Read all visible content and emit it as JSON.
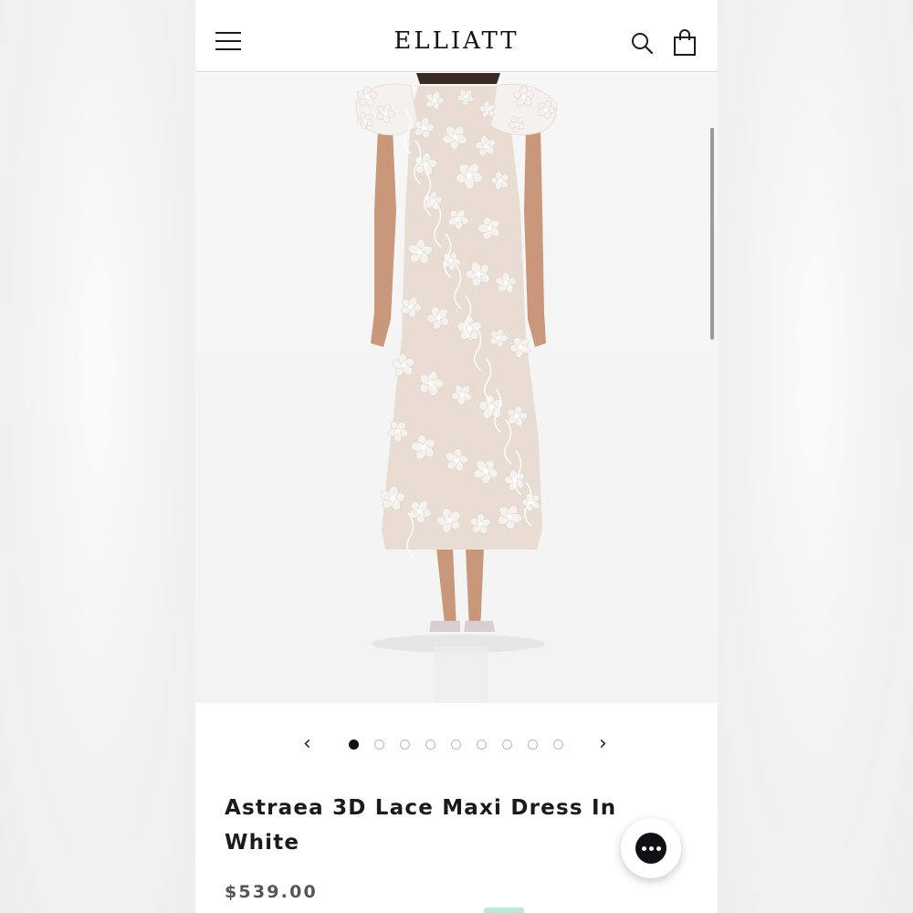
{
  "header": {
    "brand": "ELLIATT",
    "menu_icon": "hamburger-menu-icon",
    "search_icon": "search-icon",
    "cart_icon": "shopping-bag-icon"
  },
  "gallery": {
    "image_alt": "Model wearing white 3D floral lace maxi dress with puff sleeves and strappy heels",
    "dress_color": "#f5f2ee",
    "underlay_color": "#e9dcd3",
    "skin_color": "#c9987a",
    "total_images": 9,
    "active_index": 0,
    "prev_icon": "chevron-left-icon",
    "next_icon": "chevron-right-icon",
    "prev_glyph": "‹",
    "next_glyph": "›"
  },
  "product": {
    "title": "Astraea 3D Lace Maxi Dress In White",
    "price": "$539.00"
  },
  "chat": {
    "icon": "chat-bubble-icon",
    "accent": "#0f1115"
  }
}
